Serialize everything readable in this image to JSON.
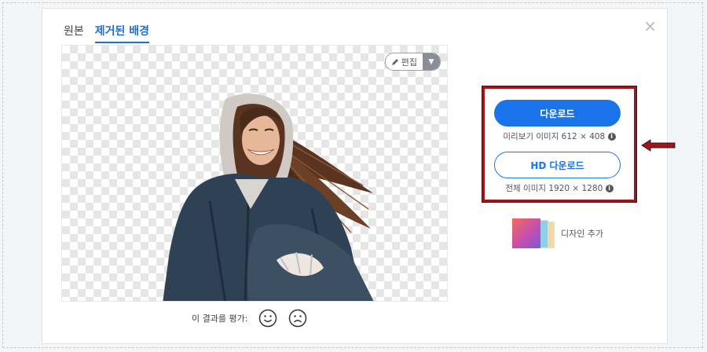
{
  "tabs": [
    {
      "label": "원본",
      "active": false
    },
    {
      "label": "제거된 배경",
      "active": true
    }
  ],
  "close_icon": "×",
  "edit": {
    "label": "편집",
    "icon": "pencil-icon",
    "dropdown_icon": "caret-down-icon"
  },
  "rating": {
    "label": "이 결과를 평가:",
    "icons": [
      "smile-icon",
      "frown-icon"
    ]
  },
  "download": {
    "button_label": "다운로드",
    "preview_info": "미리보기 이미지 612 × 408",
    "hd_button_label": "HD 다운로드",
    "full_info": "전체 이미지 1920 × 1280"
  },
  "design": {
    "label": "디자인 추가"
  },
  "colors": {
    "accent": "#1a73e8",
    "highlight_box": "#a3131b",
    "arrow": "#a3131b"
  }
}
